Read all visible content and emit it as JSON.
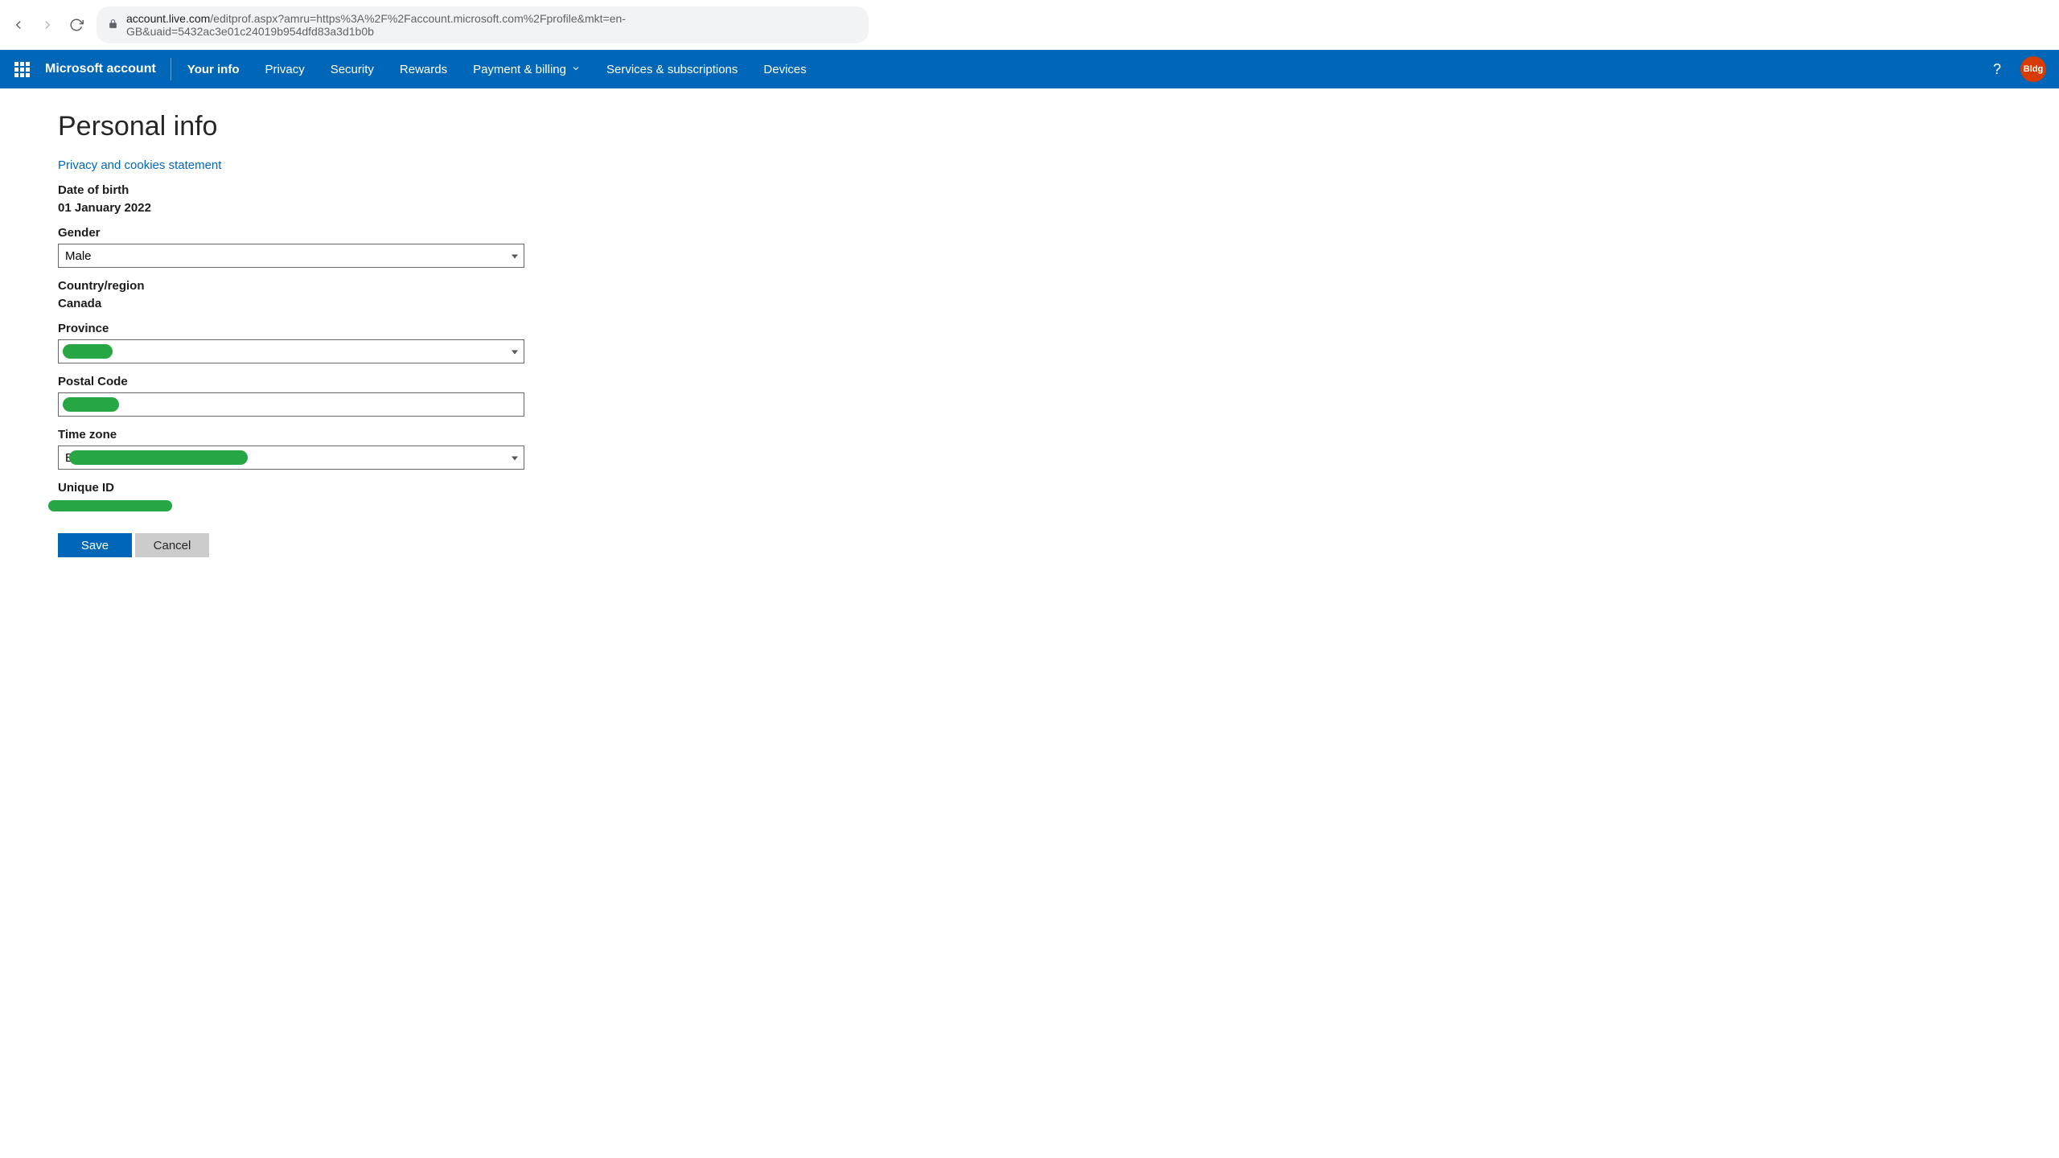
{
  "browser": {
    "url_domain": "account.live.com",
    "url_path": "/editprof.aspx?amru=https%3A%2F%2Faccount.microsoft.com%2Fprofile&mkt=en-GB&uaid=5432ac3e01c24019b954dfd83a3d1b0b"
  },
  "nav": {
    "brand": "Microsoft account",
    "items": [
      {
        "label": "Your info",
        "active": true,
        "dropdown": false
      },
      {
        "label": "Privacy",
        "active": false,
        "dropdown": false
      },
      {
        "label": "Security",
        "active": false,
        "dropdown": false
      },
      {
        "label": "Rewards",
        "active": false,
        "dropdown": false
      },
      {
        "label": "Payment & billing",
        "active": false,
        "dropdown": true
      },
      {
        "label": "Services & subscriptions",
        "active": false,
        "dropdown": false
      },
      {
        "label": "Devices",
        "active": false,
        "dropdown": false
      }
    ],
    "avatar_text": "Bldg"
  },
  "page": {
    "title": "Personal info",
    "privacy_link": "Privacy and cookies statement",
    "fields": {
      "dob_label": "Date of birth",
      "dob_value": "01 January 2022",
      "gender_label": "Gender",
      "gender_value": "Male",
      "country_label": "Country/region",
      "country_value": "Canada",
      "province_label": "Province",
      "province_value": "",
      "postal_label": "Postal Code",
      "postal_value": "",
      "tz_label": "Time zone",
      "tz_value": "E",
      "uid_label": "Unique ID",
      "uid_value": ""
    },
    "buttons": {
      "save": "Save",
      "cancel": "Cancel"
    }
  }
}
